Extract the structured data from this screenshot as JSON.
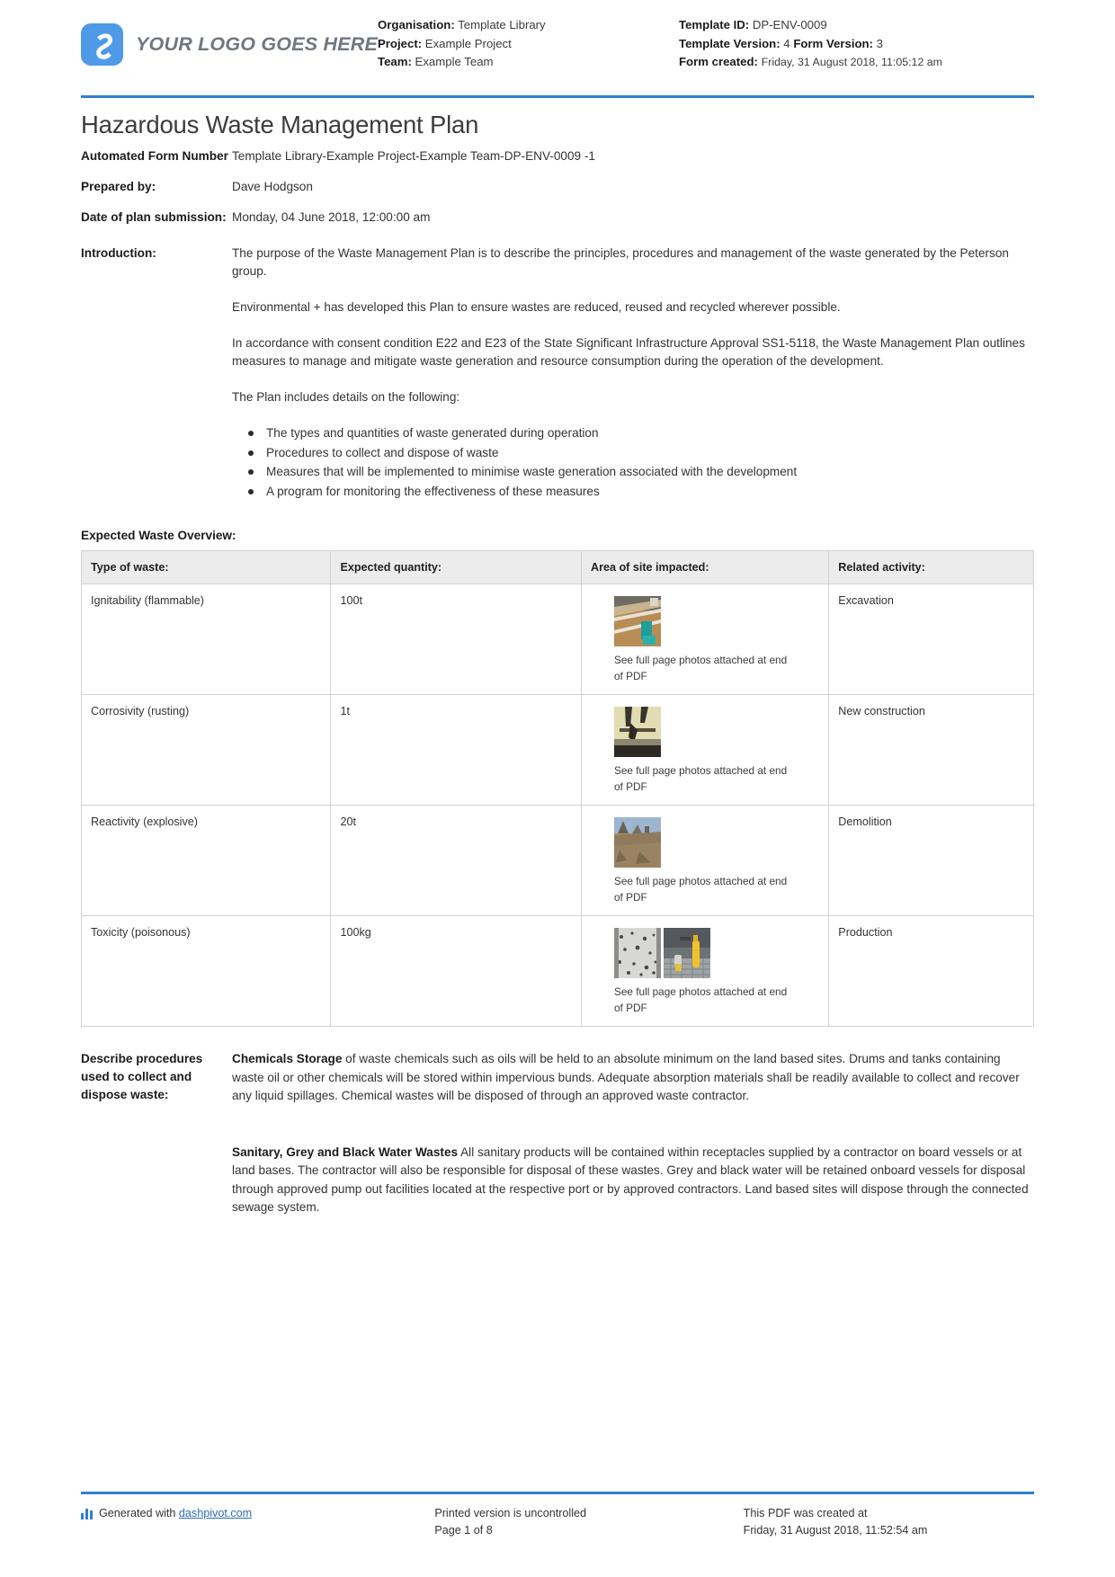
{
  "brand": {
    "logo_text": "YOUR LOGO GOES HERE",
    "accent": "#2f7fd1",
    "logo_bg": "#4f9ae8"
  },
  "header": {
    "left": {
      "organisation_label": "Organisation:",
      "organisation_value": "Template Library",
      "project_label": "Project:",
      "project_value": "Example Project",
      "team_label": "Team:",
      "team_value": "Example Team"
    },
    "right": {
      "template_id_label": "Template ID:",
      "template_id_value": "DP-ENV-0009",
      "template_version_label": "Template Version:",
      "template_version_value": "4",
      "form_version_label": "Form Version:",
      "form_version_value": "3",
      "form_created_label": "Form created:",
      "form_created_value": "Friday, 31 August 2018, 11:05:12 am"
    }
  },
  "title": "Hazardous Waste Management Plan",
  "fields": {
    "form_number_label": "Automated Form Number",
    "form_number_value": "Template Library-Example Project-Example Team-DP-ENV-0009   -1",
    "prepared_by_label": "Prepared by:",
    "prepared_by_value": "Dave Hodgson",
    "date_label": "Date of plan submission:",
    "date_value": "Monday, 04 June 2018, 12:00:00 am",
    "introduction_label": "Introduction:"
  },
  "introduction": {
    "paragraphs": [
      "The purpose of the Waste Management Plan is to describe the principles, procedures and management of the waste generated by the Peterson group.",
      "Environmental + has developed this Plan to ensure wastes are reduced, reused and recycled wherever possible.",
      "In accordance with consent condition E22 and E23 of the State Significant Infrastructure Approval SS1-5118, the Waste Management Plan outlines measures to manage and mitigate waste generation and resource consumption during the operation of the development.",
      "The Plan includes details on the following:"
    ],
    "bullets": [
      "The types and quantities of waste generated during operation",
      "Procedures to collect and dispose of waste",
      "Measures that will be implemented to minimise waste generation associated with the development",
      "A program for monitoring the effectiveness of these measures"
    ]
  },
  "table": {
    "caption": "Expected Waste Overview:",
    "columns": [
      "Type of waste:",
      "Expected quantity:",
      "Area of site impacted:",
      "Related activity:"
    ],
    "photo_note": "See full page photos attached at end of PDF",
    "rows": [
      {
        "type": "Ignitability (flammable)",
        "quantity": "100t",
        "photos": 1,
        "activity": "Excavation"
      },
      {
        "type": "Corrosivity (rusting)",
        "quantity": "1t",
        "photos": 1,
        "activity": "New construction"
      },
      {
        "type": "Reactivity (explosive)",
        "quantity": "20t",
        "photos": 1,
        "activity": "Demolition"
      },
      {
        "type": "Toxicity (poisonous)",
        "quantity": "100kg",
        "photos": 2,
        "activity": "Production"
      }
    ]
  },
  "procedures": {
    "label": "Describe procedures used to collect and dispose waste:",
    "para1_bold": "Chemicals Storage",
    "para1_rest": " of waste chemicals such as oils will be held to an absolute minimum on the land based sites. Drums and tanks containing waste oil or other chemicals will be stored within impervious bunds. Adequate absorption materials shall be readily available to collect and recover any liquid spillages. Chemical wastes will be disposed of through an approved waste contractor.",
    "para2_bold": "Sanitary, Grey and Black Water Wastes",
    "para2_rest": " All sanitary products will be contained within receptacles supplied by a contractor on board vessels or at land bases. The contractor will also be responsible for disposal of these wastes. Grey and black water will be retained onboard vessels for disposal through approved pump out facilities located at the respective port or by approved contractors. Land based sites will dispose through the connected sewage system."
  },
  "footer": {
    "generated_prefix": "Generated with ",
    "generated_link": "dashpivot.com",
    "uncontrolled": "Printed version is uncontrolled",
    "page": "Page 1 of 8",
    "created_at_label": "This PDF was created at",
    "created_at_value": "Friday, 31 August 2018, 11:52:54 am"
  }
}
